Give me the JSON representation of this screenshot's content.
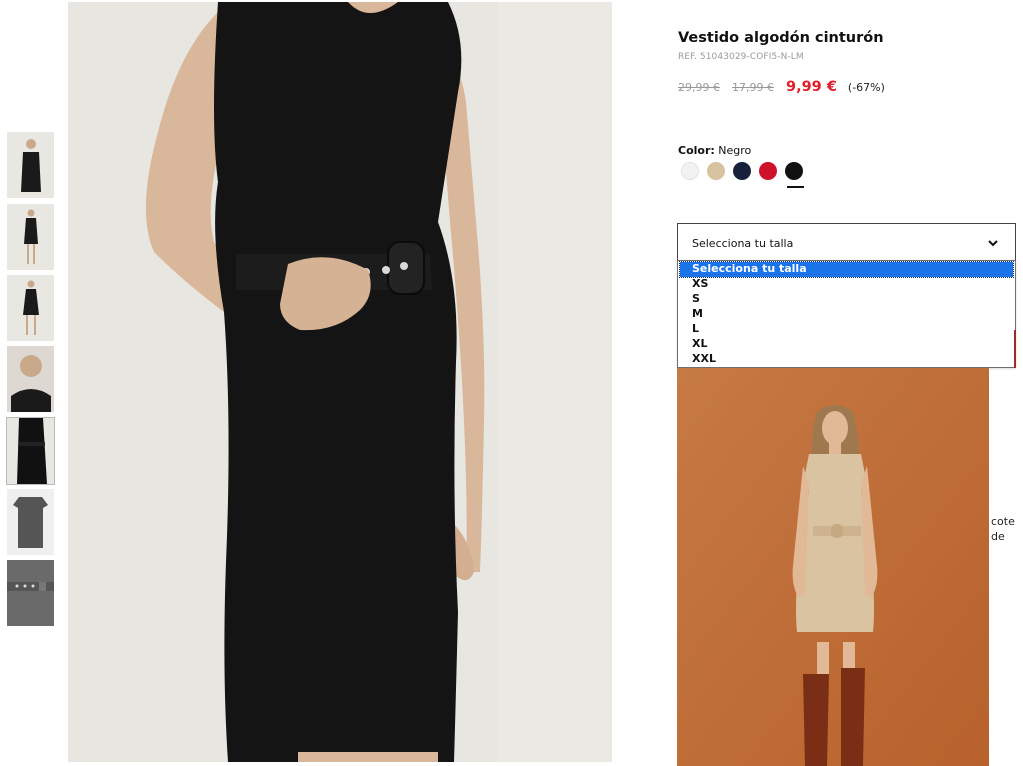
{
  "thumbnails": [
    {
      "name": "front-view"
    },
    {
      "name": "full-body-front"
    },
    {
      "name": "full-body-walk"
    },
    {
      "name": "detail-shoulder"
    },
    {
      "name": "front-belt"
    },
    {
      "name": "flat-lay"
    },
    {
      "name": "belt-detail"
    }
  ],
  "product": {
    "title": "Vestido algodón cinturón",
    "ref": "REF. 51043029-COFI5-N-LM",
    "old_price_1": "29,99 €",
    "old_price_2": "17,99 €",
    "sale_price": "9,99 €",
    "discount": "(-67%)"
  },
  "color": {
    "label": "Color:",
    "value": "Negro",
    "swatches": [
      "white",
      "beige",
      "navy",
      "red",
      "black"
    ],
    "selected": "black"
  },
  "size": {
    "placeholder": "Selecciona tu talla",
    "options": [
      "Selecciona tu talla",
      "XS",
      "S",
      "M",
      "L",
      "XL",
      "XXL"
    ],
    "selected_index": 0
  },
  "side_text": {
    "line1": "cote",
    "line2": "de"
  },
  "colors": {
    "sale": "#e11d2b",
    "select_highlight": "#1a73e8"
  }
}
